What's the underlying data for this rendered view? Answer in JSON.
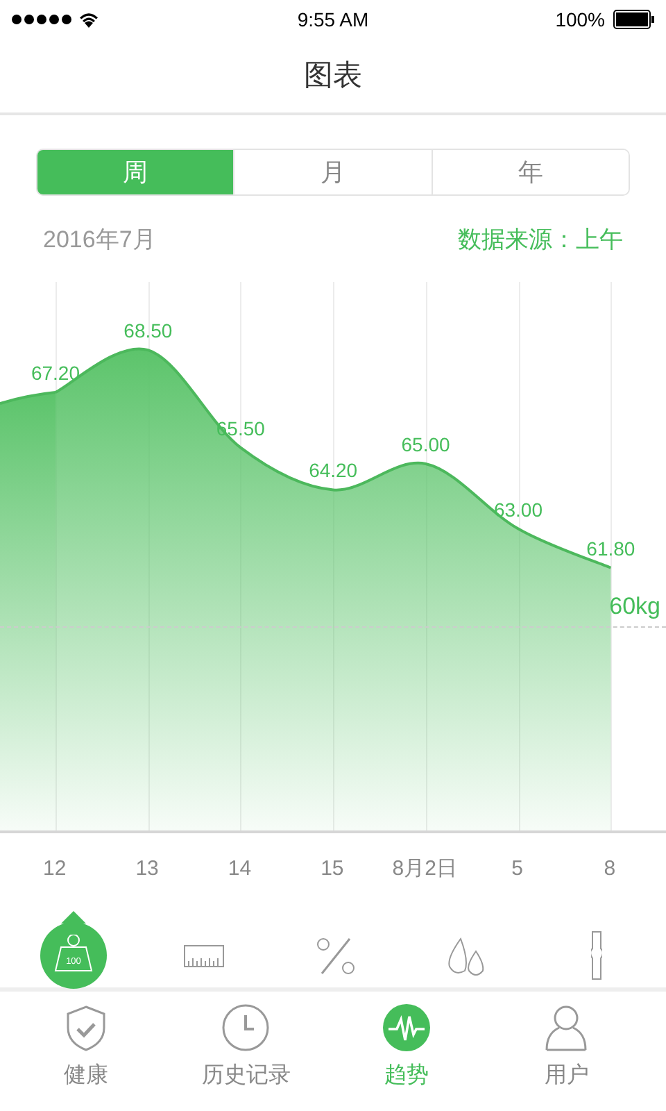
{
  "status_bar": {
    "time": "9:55 AM",
    "battery": "100%"
  },
  "header": {
    "title": "图表"
  },
  "segments": [
    {
      "label": "周",
      "selected": true
    },
    {
      "label": "月",
      "selected": false
    },
    {
      "label": "年",
      "selected": false
    }
  ],
  "period": "2016年7月",
  "data_source": "数据来源：上午",
  "chart_data": {
    "type": "area",
    "categories": [
      "12",
      "13",
      "14",
      "15",
      "8月2日",
      "5",
      "8"
    ],
    "series": [
      {
        "color": "#4cb85c",
        "values": [
          67.2,
          68.5,
          65.5,
          64.2,
          65.0,
          63.0,
          61.8
        ],
        "value_labels": [
          "67.20",
          "68.50",
          "65.50",
          "64.20",
          "65.00",
          "63.00",
          "61.80"
        ]
      }
    ],
    "data_labels": true
  },
  "goal_line": {
    "label": "60kg"
  },
  "metrics": [
    {
      "kind": "weight",
      "selected": true,
      "icon_text": "100"
    },
    {
      "kind": "ruler",
      "selected": false
    },
    {
      "kind": "percent",
      "selected": false
    },
    {
      "kind": "drops",
      "selected": false
    },
    {
      "kind": "bone",
      "selected": false
    }
  ],
  "tabs": [
    {
      "kind": "shield",
      "label": "健康",
      "selected": false
    },
    {
      "kind": "clock",
      "label": "历史记录",
      "selected": false
    },
    {
      "kind": "pulse",
      "label": "趋势",
      "selected": true
    },
    {
      "kind": "person",
      "label": "用户",
      "selected": false
    }
  ]
}
